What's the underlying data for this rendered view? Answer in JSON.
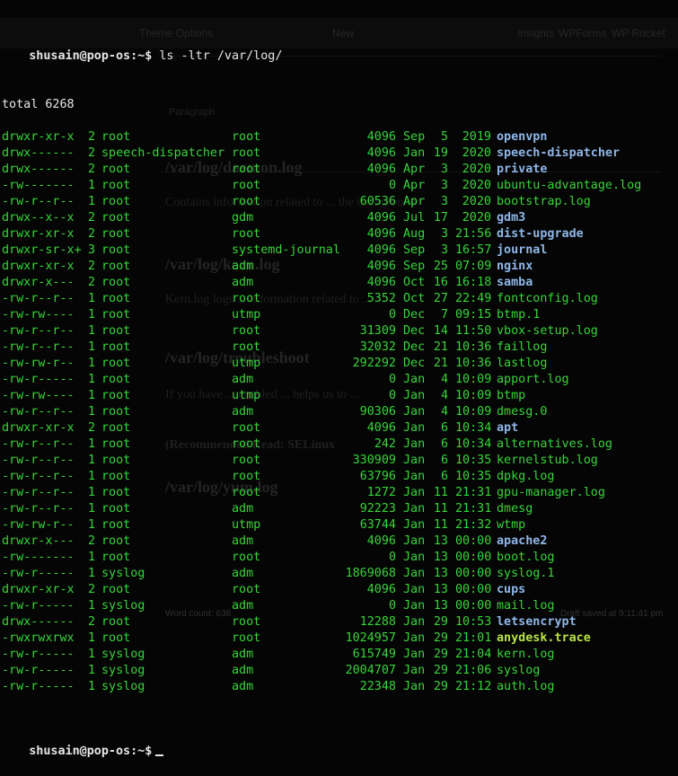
{
  "terminal": {
    "prompt": "shusain@pop-os:~$",
    "command": "ls -ltr /var/log/",
    "total_line": "total 6268",
    "rows": [
      {
        "perm": "drwxr-xr-x",
        "links": "2",
        "owner": "root",
        "group": "root",
        "size": "4096",
        "mon": "Sep",
        "day": "5",
        "time": "2019",
        "name": "openvpn",
        "kind": "dir"
      },
      {
        "perm": "drwx------",
        "links": "2",
        "owner": "speech-dispatcher",
        "group": "root",
        "size": "4096",
        "mon": "Jan",
        "day": "19",
        "time": "2020",
        "name": "speech-dispatcher",
        "kind": "dir"
      },
      {
        "perm": "drwx------",
        "links": "2",
        "owner": "root",
        "group": "root",
        "size": "4096",
        "mon": "Apr",
        "day": "3",
        "time": "2020",
        "name": "private",
        "kind": "dir"
      },
      {
        "perm": "-rw-------",
        "links": "1",
        "owner": "root",
        "group": "root",
        "size": "0",
        "mon": "Apr",
        "day": "3",
        "time": "2020",
        "name": "ubuntu-advantage.log",
        "kind": "file"
      },
      {
        "perm": "-rw-r--r--",
        "links": "1",
        "owner": "root",
        "group": "root",
        "size": "60536",
        "mon": "Apr",
        "day": "3",
        "time": "2020",
        "name": "bootstrap.log",
        "kind": "file"
      },
      {
        "perm": "drwx--x--x",
        "links": "2",
        "owner": "root",
        "group": "gdm",
        "size": "4096",
        "mon": "Jul",
        "day": "17",
        "time": "2020",
        "name": "gdm3",
        "kind": "dir"
      },
      {
        "perm": "drwxr-xr-x",
        "links": "2",
        "owner": "root",
        "group": "root",
        "size": "4096",
        "mon": "Aug",
        "day": "3",
        "time": "21:56",
        "name": "dist-upgrade",
        "kind": "dir"
      },
      {
        "perm": "drwxr-sr-x+",
        "links": "3",
        "owner": "root",
        "group": "systemd-journal",
        "size": "4096",
        "mon": "Sep",
        "day": "3",
        "time": "16:57",
        "name": "journal",
        "kind": "dir"
      },
      {
        "perm": "drwxr-xr-x",
        "links": "2",
        "owner": "root",
        "group": "adm",
        "size": "4096",
        "mon": "Sep",
        "day": "25",
        "time": "07:09",
        "name": "nginx",
        "kind": "dir"
      },
      {
        "perm": "drwxr-x---",
        "links": "2",
        "owner": "root",
        "group": "adm",
        "size": "4096",
        "mon": "Oct",
        "day": "16",
        "time": "16:18",
        "name": "samba",
        "kind": "dir"
      },
      {
        "perm": "-rw-r--r--",
        "links": "1",
        "owner": "root",
        "group": "root",
        "size": "5352",
        "mon": "Oct",
        "day": "27",
        "time": "22:49",
        "name": "fontconfig.log",
        "kind": "file"
      },
      {
        "perm": "-rw-rw----",
        "links": "1",
        "owner": "root",
        "group": "utmp",
        "size": "0",
        "mon": "Dec",
        "day": "7",
        "time": "09:15",
        "name": "btmp.1",
        "kind": "file"
      },
      {
        "perm": "-rw-r--r--",
        "links": "1",
        "owner": "root",
        "group": "root",
        "size": "31309",
        "mon": "Dec",
        "day": "14",
        "time": "11:50",
        "name": "vbox-setup.log",
        "kind": "file"
      },
      {
        "perm": "-rw-r--r--",
        "links": "1",
        "owner": "root",
        "group": "root",
        "size": "32032",
        "mon": "Dec",
        "day": "21",
        "time": "10:36",
        "name": "faillog",
        "kind": "file"
      },
      {
        "perm": "-rw-rw-r--",
        "links": "1",
        "owner": "root",
        "group": "utmp",
        "size": "292292",
        "mon": "Dec",
        "day": "21",
        "time": "10:36",
        "name": "lastlog",
        "kind": "file"
      },
      {
        "perm": "-rw-r-----",
        "links": "1",
        "owner": "root",
        "group": "adm",
        "size": "0",
        "mon": "Jan",
        "day": "4",
        "time": "10:09",
        "name": "apport.log",
        "kind": "file"
      },
      {
        "perm": "-rw-rw----",
        "links": "1",
        "owner": "root",
        "group": "utmp",
        "size": "0",
        "mon": "Jan",
        "day": "4",
        "time": "10:09",
        "name": "btmp",
        "kind": "file"
      },
      {
        "perm": "-rw-r--r--",
        "links": "1",
        "owner": "root",
        "group": "adm",
        "size": "90306",
        "mon": "Jan",
        "day": "4",
        "time": "10:09",
        "name": "dmesg.0",
        "kind": "file"
      },
      {
        "perm": "drwxr-xr-x",
        "links": "2",
        "owner": "root",
        "group": "root",
        "size": "4096",
        "mon": "Jan",
        "day": "6",
        "time": "10:34",
        "name": "apt",
        "kind": "dir"
      },
      {
        "perm": "-rw-r--r--",
        "links": "1",
        "owner": "root",
        "group": "root",
        "size": "242",
        "mon": "Jan",
        "day": "6",
        "time": "10:34",
        "name": "alternatives.log",
        "kind": "file"
      },
      {
        "perm": "-rw-r--r--",
        "links": "1",
        "owner": "root",
        "group": "root",
        "size": "330909",
        "mon": "Jan",
        "day": "6",
        "time": "10:35",
        "name": "kernelstub.log",
        "kind": "file"
      },
      {
        "perm": "-rw-r--r--",
        "links": "1",
        "owner": "root",
        "group": "root",
        "size": "63796",
        "mon": "Jan",
        "day": "6",
        "time": "10:35",
        "name": "dpkg.log",
        "kind": "file"
      },
      {
        "perm": "-rw-r--r--",
        "links": "1",
        "owner": "root",
        "group": "root",
        "size": "1272",
        "mon": "Jan",
        "day": "11",
        "time": "21:31",
        "name": "gpu-manager.log",
        "kind": "file"
      },
      {
        "perm": "-rw-r--r--",
        "links": "1",
        "owner": "root",
        "group": "adm",
        "size": "92223",
        "mon": "Jan",
        "day": "11",
        "time": "21:31",
        "name": "dmesg",
        "kind": "file"
      },
      {
        "perm": "-rw-rw-r--",
        "links": "1",
        "owner": "root",
        "group": "utmp",
        "size": "63744",
        "mon": "Jan",
        "day": "11",
        "time": "21:32",
        "name": "wtmp",
        "kind": "file"
      },
      {
        "perm": "drwxr-x---",
        "links": "2",
        "owner": "root",
        "group": "adm",
        "size": "4096",
        "mon": "Jan",
        "day": "13",
        "time": "00:00",
        "name": "apache2",
        "kind": "dir"
      },
      {
        "perm": "-rw-------",
        "links": "1",
        "owner": "root",
        "group": "root",
        "size": "0",
        "mon": "Jan",
        "day": "13",
        "time": "00:00",
        "name": "boot.log",
        "kind": "file"
      },
      {
        "perm": "-rw-r-----",
        "links": "1",
        "owner": "syslog",
        "group": "adm",
        "size": "1869068",
        "mon": "Jan",
        "day": "13",
        "time": "00:00",
        "name": "syslog.1",
        "kind": "file"
      },
      {
        "perm": "drwxr-xr-x",
        "links": "2",
        "owner": "root",
        "group": "root",
        "size": "4096",
        "mon": "Jan",
        "day": "13",
        "time": "00:00",
        "name": "cups",
        "kind": "dir"
      },
      {
        "perm": "-rw-r-----",
        "links": "1",
        "owner": "syslog",
        "group": "adm",
        "size": "0",
        "mon": "Jan",
        "day": "13",
        "time": "00:00",
        "name": "mail.log",
        "kind": "file"
      },
      {
        "perm": "drwx------",
        "links": "2",
        "owner": "root",
        "group": "root",
        "size": "12288",
        "mon": "Jan",
        "day": "29",
        "time": "10:53",
        "name": "letsencrypt",
        "kind": "dir"
      },
      {
        "perm": "-rwxrwxrwx",
        "links": "1",
        "owner": "root",
        "group": "root",
        "size": "1024957",
        "mon": "Jan",
        "day": "29",
        "time": "21:01",
        "name": "anydesk.trace",
        "kind": "exec"
      },
      {
        "perm": "-rw-r-----",
        "links": "1",
        "owner": "syslog",
        "group": "adm",
        "size": "615749",
        "mon": "Jan",
        "day": "29",
        "time": "21:04",
        "name": "kern.log",
        "kind": "file"
      },
      {
        "perm": "-rw-r-----",
        "links": "1",
        "owner": "syslog",
        "group": "adm",
        "size": "2004707",
        "mon": "Jan",
        "day": "29",
        "time": "21:06",
        "name": "syslog",
        "kind": "file"
      },
      {
        "perm": "-rw-r-----",
        "links": "1",
        "owner": "syslog",
        "group": "adm",
        "size": "22348",
        "mon": "Jan",
        "day": "29",
        "time": "21:12",
        "name": "auth.log",
        "kind": "file"
      }
    ]
  },
  "background_editor": {
    "menu": [
      "Theme Options",
      "New",
      "Insights",
      "WPForms",
      "WP Rocket"
    ],
    "block_type": "Paragraph",
    "headings": [
      "/var/log/daemon.log",
      "/var/log/kern.log",
      "/var/log/troubleshoot",
      "/var/log/yum.log"
    ],
    "paragraphs": [
      "Contains information related to ... the background",
      "Kern.log logs ... information related to ...",
      "If you have ... enabled ... helps us to ...",
      "(Recommended Read: SELinux"
    ],
    "word_count": "Word count: 638",
    "draft_status": "Draft saved at 9:11:41 pm"
  },
  "colors": {
    "background": "#050505",
    "text": "#38d43a",
    "directory": "#8fb6e8",
    "executable": "#b8e346",
    "prompt": "#e6e6e6"
  }
}
